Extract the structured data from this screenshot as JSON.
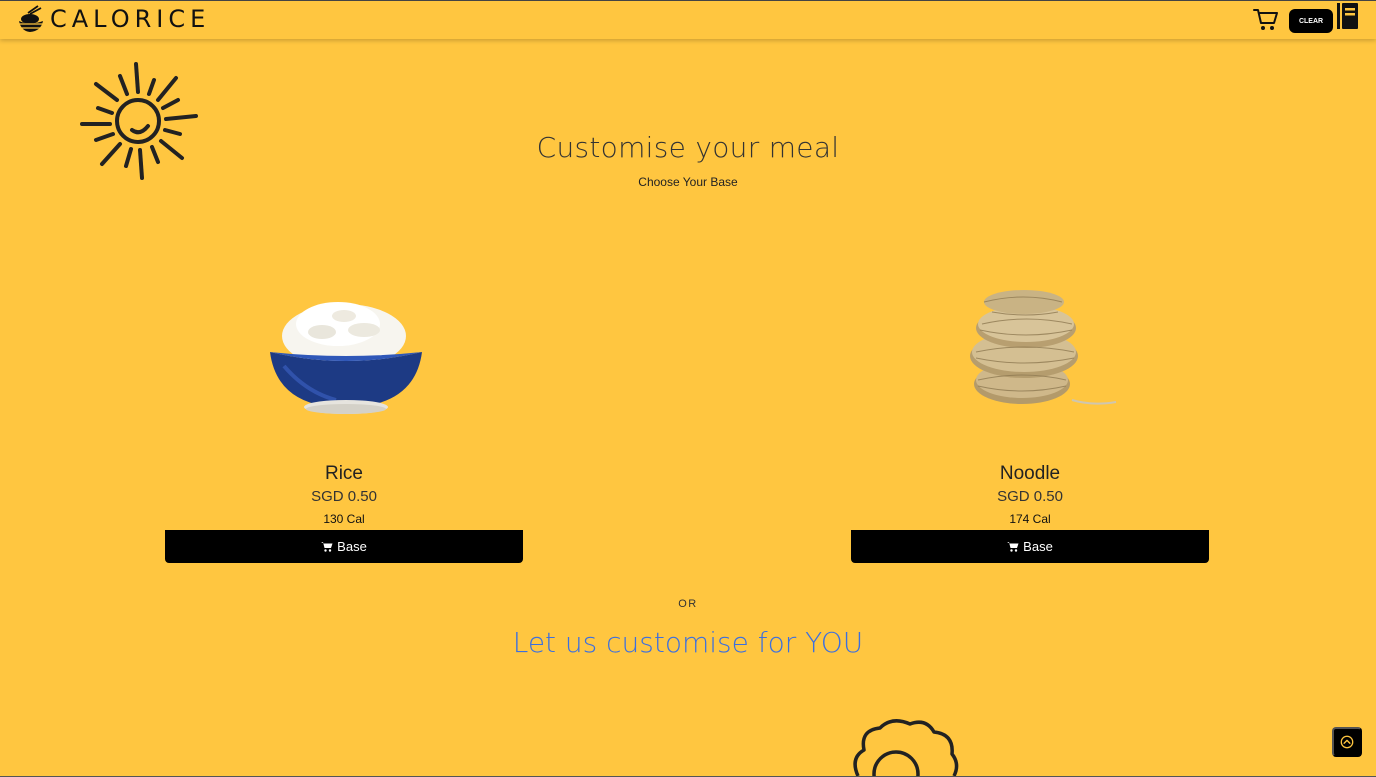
{
  "navbar": {
    "brand": "CALORICE",
    "clear_label": "CLEAR",
    "icons": [
      "bowl-logo-icon",
      "cart-icon",
      "book-icon"
    ]
  },
  "main": {
    "title": "Customise your meal",
    "subtitle": "Choose Your Base",
    "bases": [
      {
        "name": "Rice",
        "price": "SGD 0.50",
        "calories": "130 Cal",
        "button_label": "Base",
        "image": "rice-bowl"
      },
      {
        "name": "Noodle",
        "price": "SGD 0.50",
        "calories": "174 Cal",
        "button_label": "Base",
        "image": "noodle-nests"
      }
    ],
    "or_text": "OR",
    "custom_link": "Let us customise for YOU"
  },
  "colors": {
    "background": "#FFC640",
    "button": "#000000",
    "link": "#3b6fe0"
  }
}
